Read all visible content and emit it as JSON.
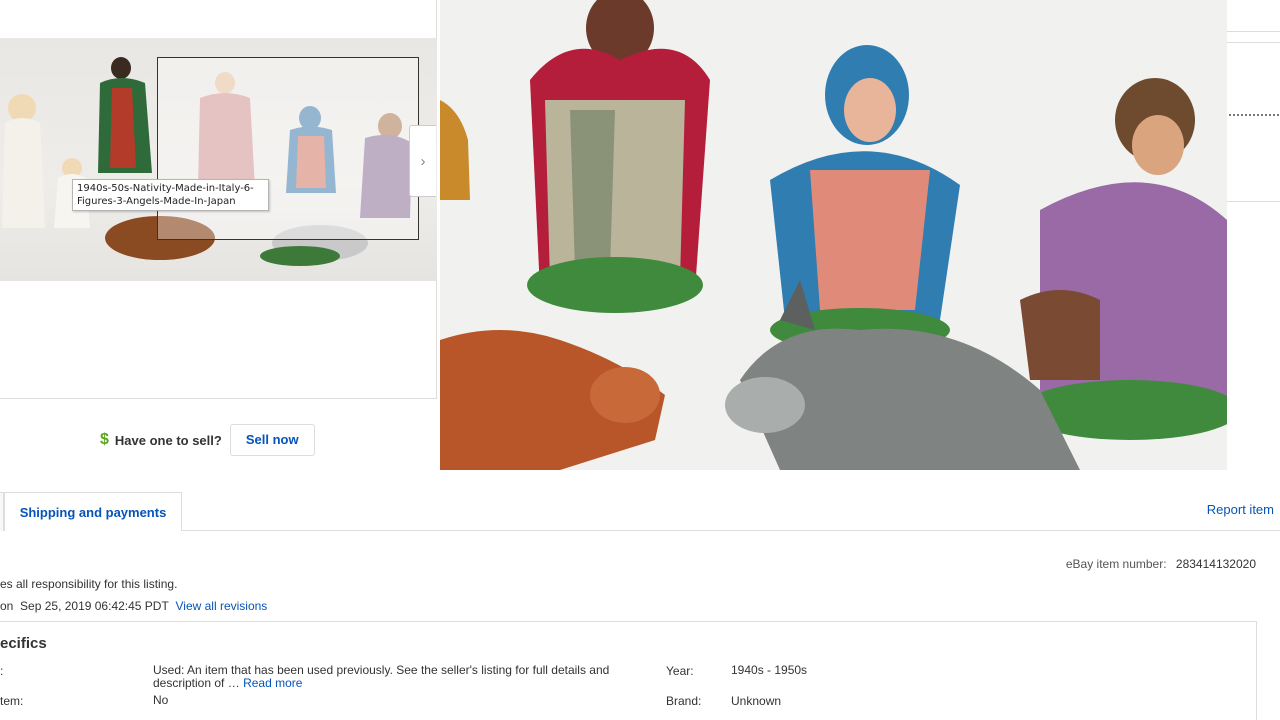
{
  "gallery": {
    "tooltip_text": "1940s-50s-Nativity-Made-in-Italy-6-Figures-3-Angels-Made-In-Japan",
    "next_icon": "chevron-right-icon"
  },
  "sell": {
    "question": "Have one to sell?",
    "button": "Sell now",
    "icon": "dollar-icon"
  },
  "tabs": {
    "shipping": "Shipping and payments",
    "report": "Report item"
  },
  "listing": {
    "item_number_label": "eBay item number:",
    "item_number": "283414132020",
    "responsibility": "es all responsibility for this listing.",
    "updated_prefix": "on",
    "updated_date": "Sep 25, 2019 06:42:45 PDT",
    "revisions_link": "View all revisions"
  },
  "specifics": {
    "title": "ecifics",
    "condition_label": ":",
    "condition_value": "Used: An item that has been used previously. See the seller's listing for full details and description of …",
    "read_more": "Read more",
    "item_label": "tem:",
    "item_value": "No",
    "year_label": "Year:",
    "year_value": "1940s - 1950s",
    "brand_label": "Brand:",
    "brand_value": "Unknown"
  },
  "colors": {
    "link": "#0654ba",
    "dollar": "#5ba71b"
  }
}
